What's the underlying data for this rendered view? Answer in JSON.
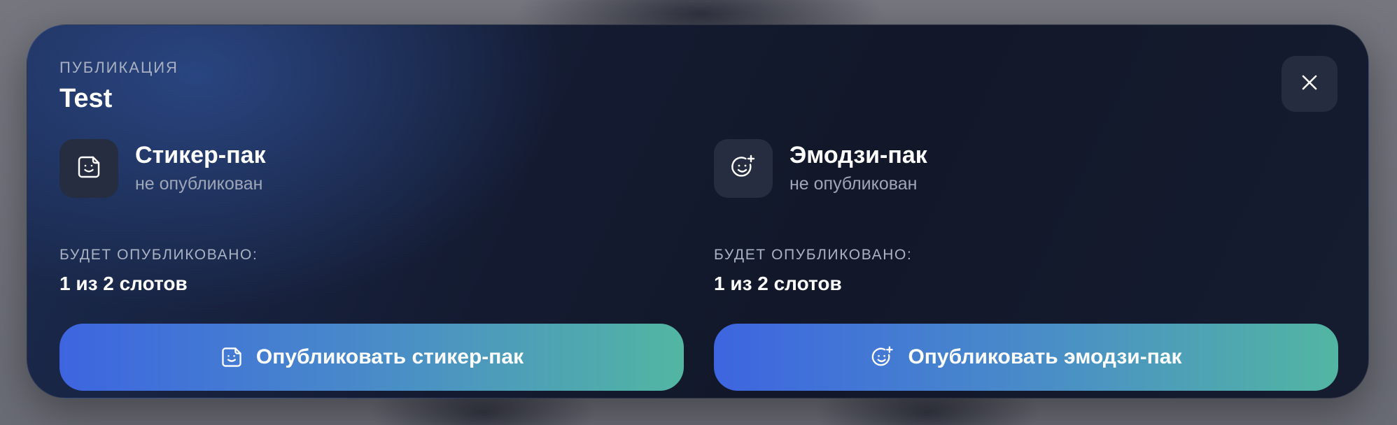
{
  "dialog": {
    "eyebrow": "ПУБЛИКАЦИЯ",
    "title": "Test",
    "close_icon": "close-icon"
  },
  "packs": [
    {
      "icon": "sticker-icon",
      "name": "Стикер-пак",
      "status": "не опубликован",
      "will_publish_label": "БУДЕТ ОПУБЛИКОВАНО:",
      "slots": "1 из 2 слотов",
      "button_label": "Опубликовать стикер-пак"
    },
    {
      "icon": "emoji-add-icon",
      "name": "Эмодзи-пак",
      "status": "не опубликован",
      "will_publish_label": "БУДЕТ ОПУБЛИКОВАНО:",
      "slots": "1 из 2 слотов",
      "button_label": "Опубликовать эмодзи-пак"
    }
  ],
  "colors": {
    "button_gradient_start": "#3d65e0",
    "button_gradient_end": "#52b6a2",
    "modal_background": "#141b31"
  }
}
